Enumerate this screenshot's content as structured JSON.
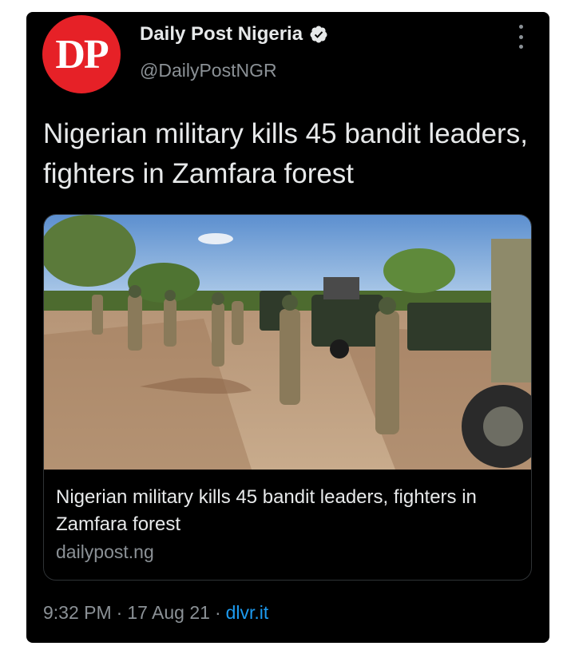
{
  "author": {
    "avatar_text": "DP",
    "name": "Daily Post Nigeria",
    "handle": "@DailyPostNGR"
  },
  "tweet_text": "Nigerian military kills 45 bandit leaders, fighters in Zamfara forest",
  "link_card": {
    "title": "Nigerian military kills 45 bandit leaders, fighters in Zamfara forest",
    "domain": "dailypost.ng"
  },
  "meta": {
    "time": "9:32 PM",
    "separator1": "·",
    "date": "17 Aug 21",
    "separator2": "·",
    "source": "dlvr.it"
  },
  "colors": {
    "background": "#000000",
    "avatar": "#e62127",
    "link": "#1d9bf0",
    "secondary_text": "#8b9196"
  },
  "icons": [
    "verified-badge-icon",
    "more-options-icon"
  ]
}
